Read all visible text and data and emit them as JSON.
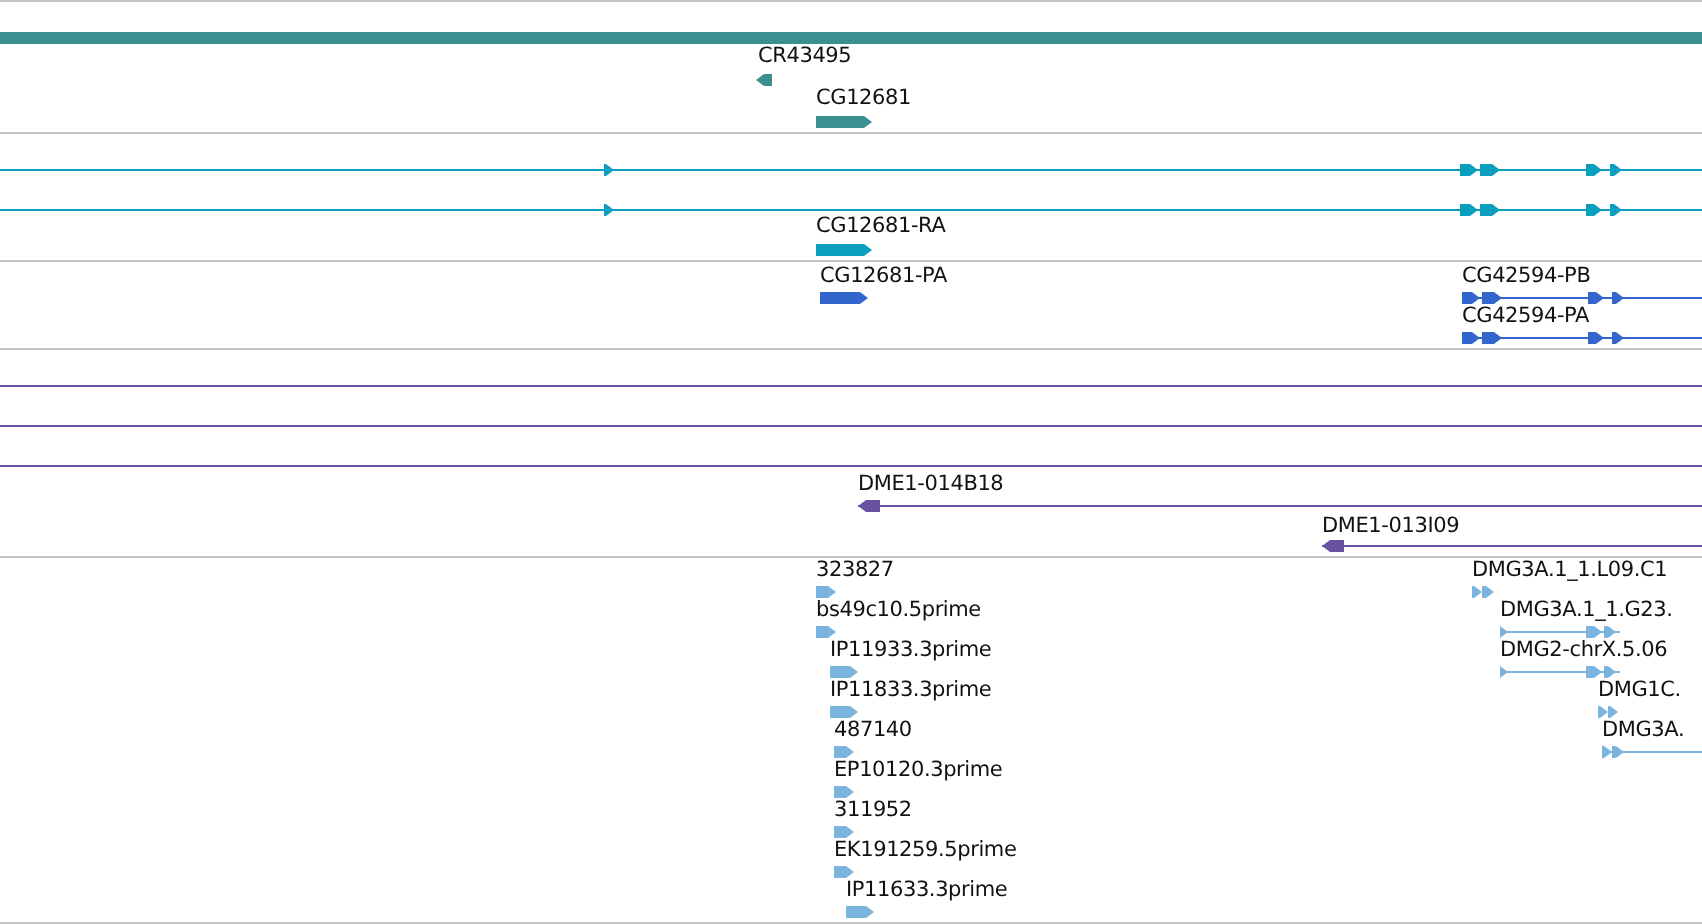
{
  "tracks": [
    {
      "color": "#3a8f8f",
      "features": [
        {
          "kind": "span-bar"
        },
        {
          "kind": "block",
          "reverse": true,
          "label": "CR43495"
        },
        {
          "kind": "block",
          "reverse": false,
          "label": "CG12681"
        }
      ]
    },
    {
      "color": "#0a9fbf",
      "features": [
        {
          "kind": "gene-model",
          "reverse": false
        },
        {
          "kind": "gene-model",
          "reverse": false
        },
        {
          "kind": "block",
          "reverse": false,
          "label": "CG12681-RA"
        }
      ]
    },
    {
      "color": "#3366cc",
      "features": [
        {
          "kind": "block",
          "reverse": false,
          "label": "CG12681-PA"
        },
        {
          "kind": "gene-model",
          "reverse": false,
          "label": "CG42594-PB"
        },
        {
          "kind": "gene-model",
          "reverse": false,
          "label": "CG42594-PA"
        }
      ]
    },
    {
      "color": "#6a52a3",
      "features": [
        {
          "kind": "line"
        },
        {
          "kind": "line"
        },
        {
          "kind": "line"
        },
        {
          "kind": "gene-model",
          "reverse": true,
          "label": "DME1-014B18"
        },
        {
          "kind": "gene-model",
          "reverse": true,
          "label": "DME1-013I09"
        }
      ]
    },
    {
      "color": "#7ab4de",
      "features": [
        {
          "kind": "block",
          "reverse": false,
          "label": "323827"
        },
        {
          "kind": "block",
          "reverse": false,
          "label": "bs49c10.5prime"
        },
        {
          "kind": "block",
          "reverse": false,
          "label": "IP11933.3prime"
        },
        {
          "kind": "block",
          "reverse": false,
          "label": "IP11833.3prime"
        },
        {
          "kind": "block",
          "reverse": false,
          "label": "487140"
        },
        {
          "kind": "block",
          "reverse": false,
          "label": "EP10120.3prime"
        },
        {
          "kind": "block",
          "reverse": false,
          "label": "311952"
        },
        {
          "kind": "block",
          "reverse": false,
          "label": "EK191259.5prime"
        },
        {
          "kind": "block",
          "reverse": false,
          "label": "IP11633.3prime"
        },
        {
          "kind": "gene-model",
          "reverse": false,
          "label": "DMG3A.1_1.L09.C1"
        },
        {
          "kind": "gene-model",
          "reverse": false,
          "label": "DMG3A.1_1.G23."
        },
        {
          "kind": "gene-model",
          "reverse": false,
          "label": "DMG2-chrX.5.06"
        },
        {
          "kind": "gene-model",
          "reverse": false,
          "label": "DMG1C."
        },
        {
          "kind": "gene-model",
          "reverse": false,
          "label": "DMG3A."
        }
      ]
    }
  ]
}
